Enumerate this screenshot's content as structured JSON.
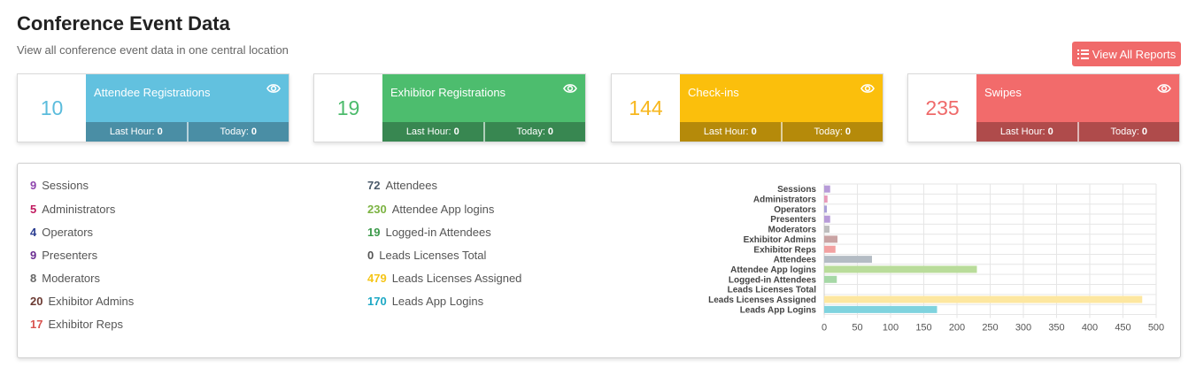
{
  "header": {
    "title": "Conference Event Data",
    "subtitle": "View all conference event data in one central location",
    "view_reports_label": "View All Reports"
  },
  "cards": [
    {
      "count": "10",
      "title": "Attendee Registrations",
      "last_hour_label": "Last Hour:",
      "last_hour": "0",
      "today_label": "Today:",
      "today": "0",
      "colors": {
        "count": "#5bbcdc",
        "panel": "#62c1df",
        "stats": "#4a8ea5"
      }
    },
    {
      "count": "19",
      "title": "Exhibitor Registrations",
      "last_hour_label": "Last Hour:",
      "last_hour": "0",
      "today_label": "Today:",
      "today": "0",
      "colors": {
        "count": "#4cbb6c",
        "panel": "#4dbd6e",
        "stats": "#388751"
      }
    },
    {
      "count": "144",
      "title": "Check-ins",
      "last_hour_label": "Last Hour:",
      "last_hour": "0",
      "today_label": "Today:",
      "today": "0",
      "colors": {
        "count": "#f7b71d",
        "panel": "#fbbf0c",
        "stats": "#b58a0a"
      }
    },
    {
      "count": "235",
      "title": "Swipes",
      "last_hour_label": "Last Hour:",
      "last_hour": "0",
      "today_label": "Today:",
      "today": "0",
      "colors": {
        "count": "#ef6a6a",
        "panel": "#f26b6b",
        "stats": "#af4b4b"
      }
    }
  ],
  "stats_left": [
    {
      "value": "9",
      "label": "Sessions",
      "color": "#8e44ad"
    },
    {
      "value": "5",
      "label": "Administrators",
      "color": "#c0185e"
    },
    {
      "value": "4",
      "label": "Operators",
      "color": "#2c3e91"
    },
    {
      "value": "9",
      "label": "Presenters",
      "color": "#6a2c91"
    },
    {
      "value": "8",
      "label": "Moderators",
      "color": "#666666"
    },
    {
      "value": "20",
      "label": "Exhibitor Admins",
      "color": "#6b3a32"
    },
    {
      "value": "17",
      "label": "Exhibitor Reps",
      "color": "#d9534f"
    }
  ],
  "stats_right": [
    {
      "value": "72",
      "label": "Attendees",
      "color": "#4a5a6a"
    },
    {
      "value": "230",
      "label": "Attendee App logins",
      "color": "#7cb342"
    },
    {
      "value": "19",
      "label": "Logged-in Attendees",
      "color": "#3c9a4a"
    },
    {
      "value": "0",
      "label": "Leads Licenses Total",
      "color": "#555555"
    },
    {
      "value": "479",
      "label": "Leads Licenses Assigned",
      "color": "#f5c518"
    },
    {
      "value": "170",
      "label": "Leads App Logins",
      "color": "#1da8c4"
    }
  ],
  "chart_data": {
    "type": "bar",
    "orientation": "horizontal",
    "categories": [
      "Sessions",
      "Administrators",
      "Operators",
      "Presenters",
      "Moderators",
      "Exhibitor Admins",
      "Exhibitor Reps",
      "Attendees",
      "Attendee App logins",
      "Logged-in Attendees",
      "Leads Licenses Total",
      "Leads Licenses Assigned",
      "Leads App Logins"
    ],
    "values": [
      9,
      5,
      4,
      9,
      8,
      20,
      17,
      72,
      230,
      19,
      0,
      479,
      170
    ],
    "colors": [
      "#b79bd8",
      "#e89ab8",
      "#a9a0d8",
      "#b79bd8",
      "#bdbdbd",
      "#c9a3a3",
      "#f2a1a1",
      "#b4bcc4",
      "#b9dc9a",
      "#a6d8a6",
      "#cccccc",
      "#fde7a0",
      "#7fd3de"
    ],
    "x_ticks": [
      0,
      50,
      100,
      150,
      200,
      250,
      300,
      350,
      400,
      450,
      500
    ],
    "xlim": [
      0,
      500
    ],
    "grid": true,
    "legend": false
  }
}
